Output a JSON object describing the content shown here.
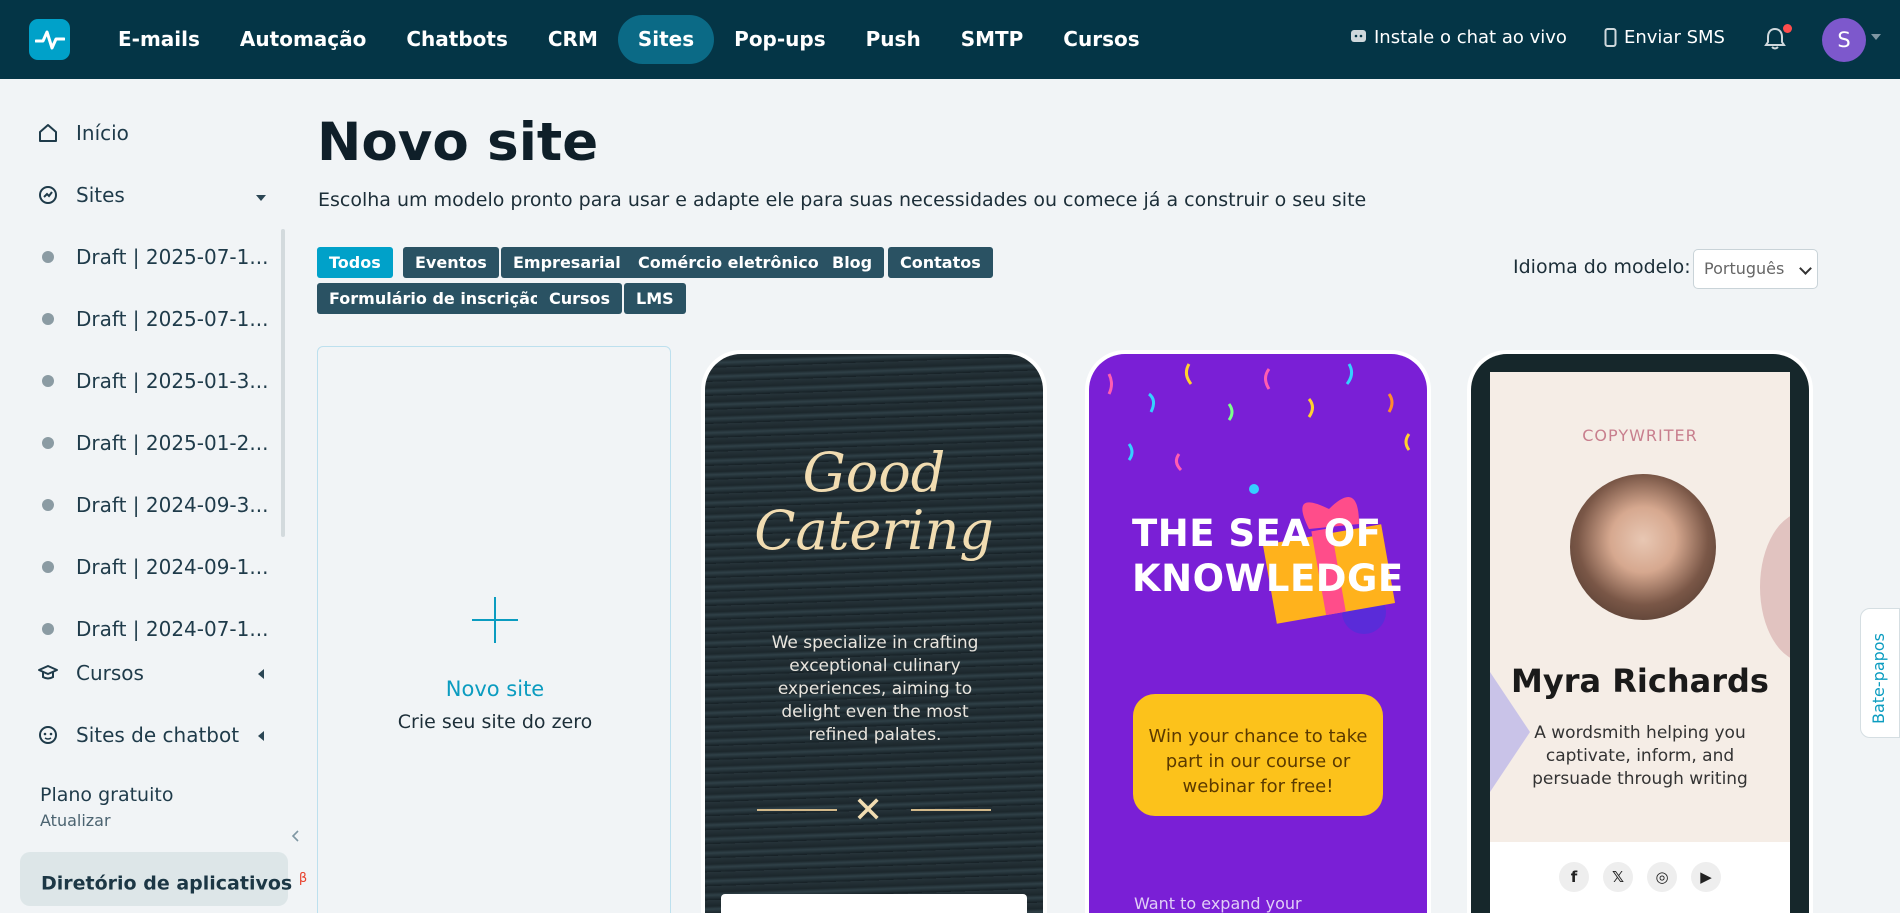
{
  "topnav": {
    "items": [
      "E-mails",
      "Automação",
      "Chatbots",
      "CRM",
      "Sites",
      "Pop-ups",
      "Push",
      "SMTP",
      "Cursos"
    ],
    "active": "Sites",
    "live_chat": "Instale o chat ao vivo",
    "sms": "Enviar SMS",
    "avatar_initial": "S"
  },
  "sidebar": {
    "inicio": "Início",
    "sites": "Sites",
    "drafts": [
      "Draft | 2025-07-1...",
      "Draft | 2025-07-1...",
      "Draft | 2025-01-3...",
      "Draft | 2025-01-2...",
      "Draft | 2024-09-3...",
      "Draft | 2024-09-1...",
      "Draft | 2024-07-1..."
    ],
    "cursos": "Cursos",
    "chatbot_sites": "Sites de chatbot",
    "plan_title": "Plano gratuito",
    "plan_action": "Atualizar",
    "apps_directory": "Diretório de aplicativos",
    "apps_badge": "β"
  },
  "main": {
    "title": "Novo site",
    "subtitle": "Escolha um modelo pronto para usar e adapte ele para suas necessidades ou comece já a construir o seu site",
    "filters_row1": [
      "Todos",
      "Eventos",
      "Empresarial",
      "Comércio eletrônico",
      "Blog",
      "Contatos"
    ],
    "filters_row2": [
      "Formulário de inscrição",
      "Cursos",
      "LMS"
    ],
    "active_filter": "Todos",
    "language_label": "Idioma do modelo:",
    "language_value": "Português"
  },
  "new_card": {
    "title": "Novo site",
    "subtitle": "Crie seu site do zero"
  },
  "templates": {
    "catering": {
      "title_line1": "Good",
      "title_line2": "Catering",
      "text": "We specialize in crafting exceptional culinary experiences, aiming to delight even the most refined palates."
    },
    "knowledge": {
      "title_line1": "THE SEA OF",
      "title_line2": "KNOWLEDGE",
      "box": "Win your chance to take part in our course or webinar for free!",
      "footer": "Want to expand your"
    },
    "copywriter": {
      "role": "COPYWRITER",
      "name": "Myra Richards",
      "desc": "A wordsmith helping you captivate, inform, and persuade through writing",
      "social": [
        "f",
        "𝕏",
        "◎",
        "▶"
      ]
    }
  },
  "chat_tab": "Bate-papos",
  "colors": {
    "topbar": "#043546",
    "accent": "#00a1c9",
    "tag": "#2a5263"
  }
}
